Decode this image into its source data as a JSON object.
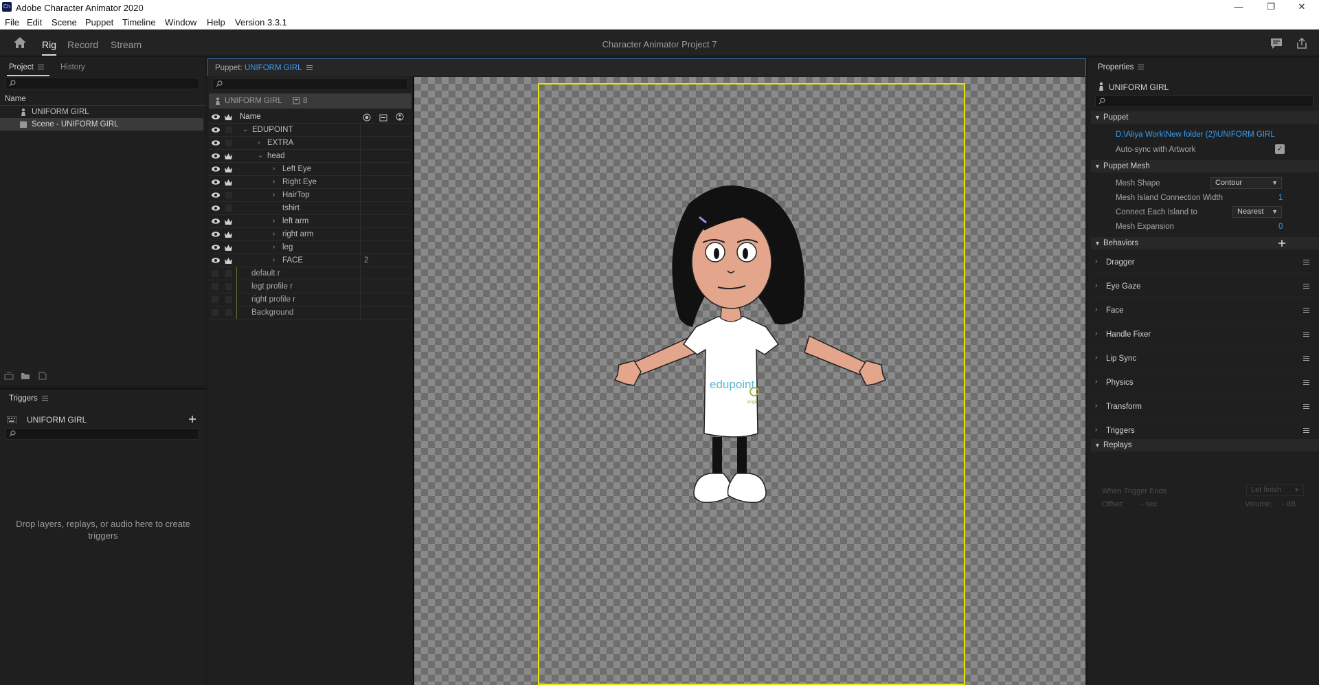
{
  "window": {
    "app_title": "Adobe Character Animator 2020",
    "app_icon": "Ch",
    "minimize": "—",
    "maximize": "❐",
    "close": "✕"
  },
  "menu": [
    "File",
    "Edit",
    "Scene",
    "Puppet",
    "Timeline",
    "Window",
    "Help",
    "Version 3.3.1"
  ],
  "workspace": {
    "modes": [
      "Rig",
      "Record",
      "Stream"
    ],
    "active_mode": "Rig",
    "project_title": "Character Animator Project 7"
  },
  "project_panel": {
    "tabs": [
      "Project",
      "History"
    ],
    "column_header": "Name",
    "items": [
      {
        "label": "UNIFORM GIRL",
        "icon": "puppet-icon"
      },
      {
        "label": "Scene - UNIFORM GIRL",
        "icon": "scene-icon",
        "selected": true
      }
    ]
  },
  "triggers_panel": {
    "title": "Triggers",
    "puppet_name": "UNIFORM GIRL",
    "hint": "Drop layers, replays, or audio here to create triggers"
  },
  "puppet_panel": {
    "label": "Puppet:",
    "puppet_name": "UNIFORM GIRL",
    "layer_header_name": "UNIFORM GIRL",
    "layer_header_count": "8",
    "column_name": "Name",
    "layers": [
      {
        "name": "EDUPOINT",
        "depth": 0,
        "expand": "v",
        "eye": true,
        "crown": false
      },
      {
        "name": "EXTRA",
        "depth": 1,
        "expand": ">",
        "eye": true,
        "crown": false
      },
      {
        "name": "head",
        "depth": 1,
        "expand": "v",
        "eye": true,
        "crown": true
      },
      {
        "name": "Left Eye",
        "depth": 2,
        "expand": ">",
        "eye": true,
        "crown": true
      },
      {
        "name": "Right Eye",
        "depth": 2,
        "expand": ">",
        "eye": true,
        "crown": true
      },
      {
        "name": "HairTop",
        "depth": 2,
        "expand": ">",
        "eye": true,
        "crown": false
      },
      {
        "name": "tshirt",
        "depth": 2,
        "expand": "",
        "eye": true,
        "crown": false
      },
      {
        "name": "left arm",
        "depth": 2,
        "expand": ">",
        "eye": true,
        "crown": true
      },
      {
        "name": "right arm",
        "depth": 2,
        "expand": ">",
        "eye": true,
        "crown": true
      },
      {
        "name": "leg",
        "depth": 2,
        "expand": ">",
        "eye": true,
        "crown": true
      },
      {
        "name": "FACE",
        "depth": 2,
        "expand": ">",
        "eye": true,
        "crown": true,
        "count": "2"
      },
      {
        "name": "default r",
        "depth": -1,
        "expand": "",
        "eye": false,
        "crown": false
      },
      {
        "name": "legt profile r",
        "depth": -1,
        "expand": "",
        "eye": false,
        "crown": false
      },
      {
        "name": "right profile r",
        "depth": -1,
        "expand": "",
        "eye": false,
        "crown": false
      },
      {
        "name": "Background",
        "depth": -1,
        "expand": "",
        "eye": false,
        "crown": false
      }
    ]
  },
  "stage": {
    "tshirt_logo": "edupoint",
    "tshirt_sublogo": "origin"
  },
  "properties": {
    "title": "Properties",
    "puppet_name": "UNIFORM GIRL",
    "puppet_section": "Puppet",
    "puppet_path": "D:\\Aliya Work\\New folder (2)\\UNIFORM GIRL",
    "auto_sync_label": "Auto-sync with Artwork",
    "mesh_section": "Puppet Mesh",
    "mesh_shape_label": "Mesh Shape",
    "mesh_shape_value": "Contour",
    "island_width_label": "Mesh Island Connection Width",
    "island_width_value": "1",
    "connect_label": "Connect Each Island to",
    "connect_value": "Nearest",
    "expansion_label": "Mesh Expansion",
    "expansion_value": "0",
    "behaviors_section": "Behaviors",
    "behaviors": [
      "Dragger",
      "Eye Gaze",
      "Face",
      "Handle Fixer",
      "Lip Sync",
      "Physics",
      "Transform",
      "Triggers"
    ],
    "replays_section": "Replays",
    "when_trigger_ends_label": "When Trigger Ends",
    "when_trigger_ends_value": "Let finish",
    "offset_label": "Offset:",
    "offset_value": "- sec",
    "volume_label": "Volume:",
    "volume_value": "- dB"
  },
  "colors": {
    "accent_blue": "#3a9cf0",
    "artboard_yellow": "#e6e600",
    "panel_bg": "#1f1f1f"
  }
}
